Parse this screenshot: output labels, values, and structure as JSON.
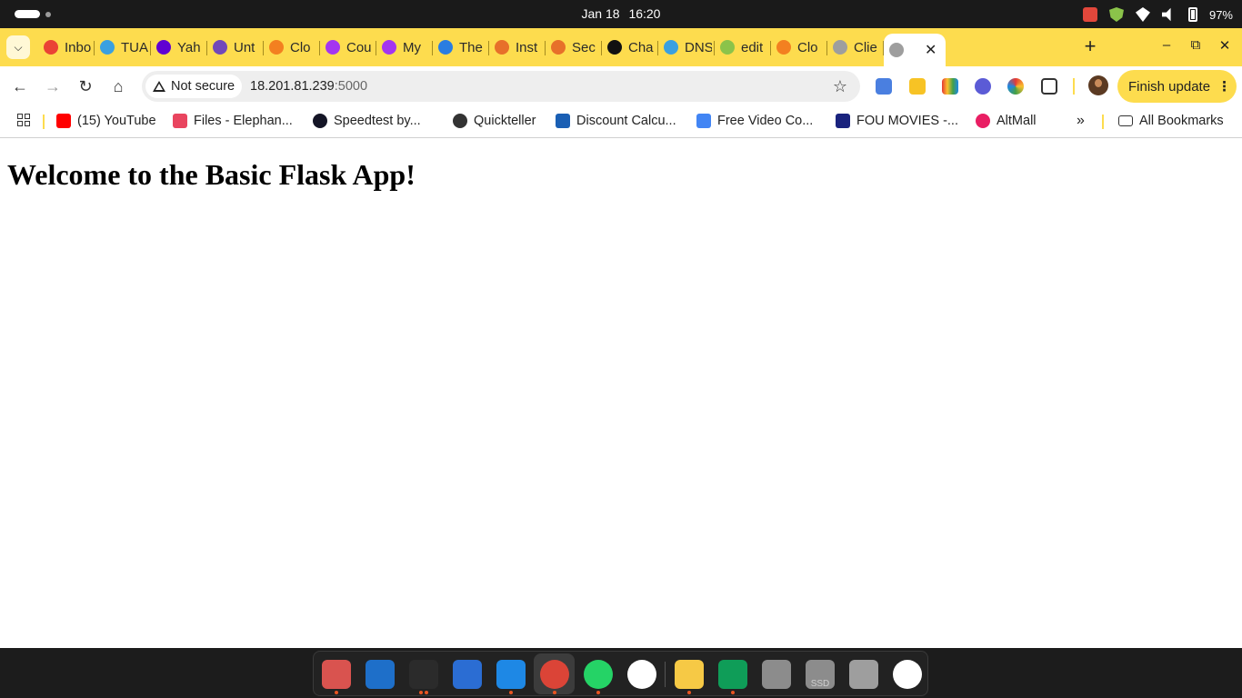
{
  "system_bar": {
    "date": "Jan 18",
    "time": "16:20",
    "battery": "97%"
  },
  "tabs": [
    {
      "label": "Inbo",
      "icon": "gmail-icon",
      "color": "#ea4335"
    },
    {
      "label": "TUA",
      "icon": "tua-icon",
      "color": "#3aa0e0"
    },
    {
      "label": "Yah",
      "icon": "yahoo-icon",
      "color": "#6001d2"
    },
    {
      "label": "Unt",
      "icon": "forms-icon",
      "color": "#7248b9"
    },
    {
      "label": "Clo",
      "icon": "cloudflare-icon",
      "color": "#f38020"
    },
    {
      "label": "Cou",
      "icon": "udemy-icon",
      "color": "#a435f0"
    },
    {
      "label": "My",
      "icon": "udemy-icon",
      "color": "#a435f0"
    },
    {
      "label": "The",
      "icon": "azure-icon",
      "color": "#2a7de1"
    },
    {
      "label": "Inst",
      "icon": "aws-icon",
      "color": "#e7702a"
    },
    {
      "label": "Sec",
      "icon": "aws-icon",
      "color": "#e7702a"
    },
    {
      "label": "Cha",
      "icon": "chatgpt-icon",
      "color": "#111111"
    },
    {
      "label": "DNS",
      "icon": "dns-icon",
      "color": "#3aa0e0"
    },
    {
      "label": "edit",
      "icon": "edit-icon",
      "color": "#8bc34a"
    },
    {
      "label": "Clo",
      "icon": "cloudflare-icon",
      "color": "#f38020"
    },
    {
      "label": "Clie",
      "icon": "globe-icon",
      "color": "#9e9e9e"
    }
  ],
  "toolbar": {
    "security_label": "Not secure",
    "url_host": "18.201.81.239",
    "url_port": ":5000",
    "finish_update_label": "Finish update"
  },
  "bookmarks": [
    {
      "label": "(15) YouTube",
      "icon": "youtube-icon",
      "color": "#ff0000"
    },
    {
      "label": "Files - Elephan...",
      "icon": "files-icon",
      "color": "#e9455f"
    },
    {
      "label": "Speedtest by...",
      "icon": "speedtest-icon",
      "color": "#141526"
    },
    {
      "label": "Quickteller",
      "icon": "globe-icon",
      "color": "#333333"
    },
    {
      "label": "Discount Calcu...",
      "icon": "calculator-icon",
      "color": "#1a5fb4"
    },
    {
      "label": "Free Video Co...",
      "icon": "google-icon",
      "color": "#4285f4"
    },
    {
      "label": "FOU MOVIES -...",
      "icon": "movies-icon",
      "color": "#1a237e"
    },
    {
      "label": "AltMall",
      "icon": "altmall-icon",
      "color": "#e91e63"
    }
  ],
  "all_bookmarks_label": "All Bookmarks",
  "page": {
    "heading": "Welcome to the Basic Flask App!"
  },
  "dock": [
    {
      "name": "files-app",
      "color": "#d9534f"
    },
    {
      "name": "text-document-app",
      "color": "#1e6fc9"
    },
    {
      "name": "terminal-app",
      "color": "#2b2b2b"
    },
    {
      "name": "system-monitor-app",
      "color": "#2b6dd3"
    },
    {
      "name": "vscode-app",
      "color": "#1e88e5"
    },
    {
      "name": "chrome-app",
      "color": "#db4437"
    },
    {
      "name": "whatsapp-app",
      "color": "#25d366"
    },
    {
      "name": "slack-app",
      "color": "#ffffff"
    },
    {
      "name": "text-editor-app",
      "color": "#f6c945"
    },
    {
      "name": "google-drive-app",
      "color": "#0f9d58"
    },
    {
      "name": "disk-app",
      "color": "#8c8c8c"
    },
    {
      "name": "ssd-app",
      "color": "#8c8c8c"
    },
    {
      "name": "trash-app",
      "color": "#9e9e9e"
    },
    {
      "name": "ubuntu-app",
      "color": "#ffffff"
    }
  ],
  "dock_ssd_label": "SSD"
}
